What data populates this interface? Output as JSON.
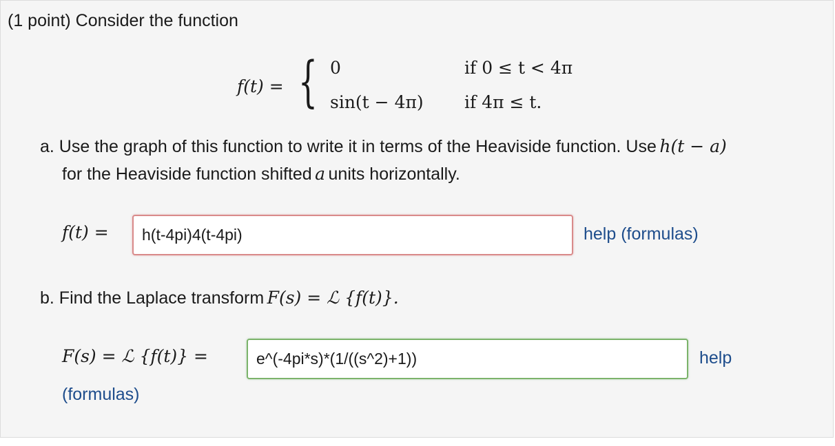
{
  "problem": {
    "intro": "(1 point) Consider the function",
    "definition": {
      "lhs": "f(t) =",
      "case1_value": "0",
      "case1_condition": "if 0 ≤ t < 4π",
      "case2_value": "sin(t − 4π)",
      "case2_condition": "if 4π ≤ t."
    }
  },
  "part_a": {
    "prompt_line1": "a. Use the graph of this function to write it in terms of the Heaviside function. Use",
    "prompt_math": "h(t − a)",
    "prompt_line2_pre": "for the Heaviside function shifted",
    "prompt_var": "a",
    "prompt_line2_post": "units horizontally.",
    "label": "f(t) =",
    "answer_value": "h(t-4pi)4(t-4pi)",
    "answer_status": "incorrect",
    "help_link": "help (formulas)"
  },
  "part_b": {
    "prompt_pre": "b. Find the Laplace transform",
    "prompt_math": "F(s) = ℒ {f(t)}.",
    "label": "F(s) = ℒ {f(t)} =",
    "answer_value": "e^(-4pi*s)*(1/((s^2)+1))",
    "answer_status": "correct",
    "help_link": "help",
    "help_link_2": "(formulas)"
  },
  "colors": {
    "panel_bg": "#f5f5f5",
    "link": "#1e4d8c",
    "incorrect_border": "#d98a8a",
    "correct_border": "#7bb36a"
  }
}
